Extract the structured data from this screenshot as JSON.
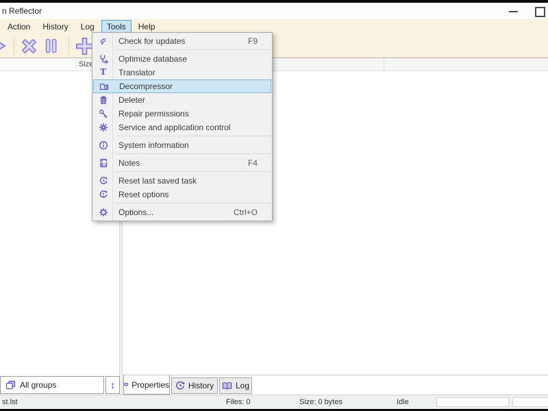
{
  "window": {
    "title": "n Reflector"
  },
  "menubar": {
    "items": [
      {
        "label": "Action"
      },
      {
        "label": "History"
      },
      {
        "label": "Log"
      },
      {
        "label": "Tools",
        "active": true
      },
      {
        "label": "Help"
      }
    ]
  },
  "toolbar": {
    "buttons": [
      {
        "icon": "play-icon"
      },
      {
        "icon": "cancel-icon"
      },
      {
        "icon": "pause-icon"
      },
      {
        "icon": "add-icon"
      }
    ]
  },
  "tools_menu": {
    "items": [
      {
        "icon": "wifi-icon",
        "label": "Check for updates",
        "shortcut": "F9"
      },
      {
        "icon": "stethoscope-icon",
        "label": "Optimize database"
      },
      {
        "icon": "letter-t-icon",
        "label": "Translator"
      },
      {
        "icon": "folder-icon",
        "label": "Decompressor",
        "highlighted": true
      },
      {
        "icon": "trash-icon",
        "label": "Deleter"
      },
      {
        "icon": "key-icon",
        "label": "Repair permissions"
      },
      {
        "icon": "gear-icon",
        "label": "Service and application control"
      },
      {
        "icon": "info-icon",
        "label": "System information"
      },
      {
        "icon": "notebook-icon",
        "label": "Notes",
        "shortcut": "F4"
      },
      {
        "icon": "reset-icon",
        "label": "Reset last saved task"
      },
      {
        "icon": "reset-icon",
        "label": "Reset options"
      },
      {
        "icon": "gear-outline-icon",
        "label": "Options...",
        "shortcut": "Ctrl+O"
      }
    ]
  },
  "file_list": {
    "size_column_header": "Size"
  },
  "group_filter": {
    "value": "All groups",
    "sort_glyph": "↕"
  },
  "bottom_tabs": [
    {
      "label": "Properties",
      "icon": "monitor-icon",
      "selected": true
    },
    {
      "label": "History",
      "icon": "history-icon",
      "selected": false
    },
    {
      "label": "Log",
      "icon": "book-icon",
      "selected": false
    }
  ],
  "status_bar": {
    "file_name": "st.lst",
    "files_count": "Files: 0",
    "total_size": "Size: 0 bytes",
    "state": "Idle"
  },
  "colors": {
    "accent_purple": "#564fc2",
    "toolbar_cream": "#f9f2e0",
    "menu_highlight": "#cde7f5",
    "menu_highlight_border": "#7fb5da"
  }
}
